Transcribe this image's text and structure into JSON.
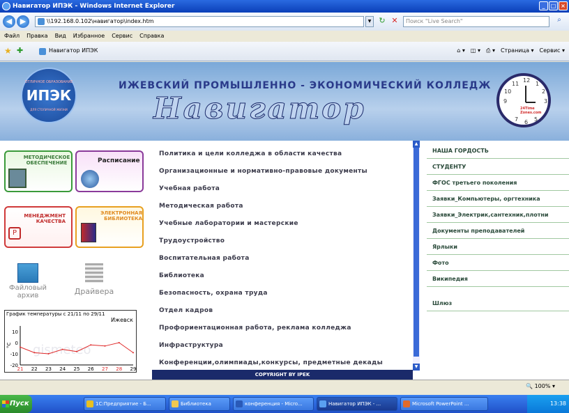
{
  "window": {
    "title": "Навигатор ИПЭК - Windows Internet Explorer"
  },
  "address": {
    "url": "\\\\192.168.0.102\\навигатор\\index.htm",
    "search_placeholder": "Поиск \"Live Search\""
  },
  "menu": [
    "Файл",
    "Правка",
    "Вид",
    "Избранное",
    "Сервис",
    "Справка"
  ],
  "tab": {
    "label": "Навигатор ИПЭК"
  },
  "commands": [
    "Страница ▾",
    "Сервис ▾"
  ],
  "banner": {
    "college": "ИЖЕВСКИЙ ПРОМЫШЛЕННО - ЭКОНОМИЧЕСКИЙ КОЛЛЕДЖ",
    "title": "Навигатор",
    "logo_top": "ОТЛИЧНОЕ ОБРАЗОВАНИЕ",
    "logo_main": "ИПЭК",
    "logo_bottom": "ДЛЯ СТОЛИЧНОЙ ЖИЗНИ",
    "clock_brand": "24Time Zones.com",
    "clock_numbers": [
      "12",
      "1",
      "2",
      "3",
      "5",
      "6",
      "7",
      "9",
      "10",
      "11"
    ]
  },
  "tiles": {
    "method": "МЕТОДИЧЕСКОЕ ОБЕСПЕЧЕНИЕ",
    "schedule": "Расписание",
    "management": "МЕНЕДЖМЕНТ КАЧЕСТВА",
    "library": "ЭЛЕКТРОННАЯ БИБЛИОТЕКА",
    "archive": "Файловый архив",
    "drivers": "Драйвера"
  },
  "middle_links": [
    "Политика и цели колледжа в области качества",
    "Организационные и нормативно-правовые документы",
    "Учебная работа",
    "Методическая работа",
    "Учебные лаборатории и мастерские",
    "Трудоустройство",
    "Воспитательная работа",
    "Библиотека",
    "Безопасность, охрана труда",
    "Отдел кадров",
    "Профориентационная работа, реклама колледжа",
    "Инфраструктура",
    "Конференции,олимпиады,конкурсы, предметные декады"
  ],
  "right_links": [
    "НАША ГОРДОСТЬ",
    "СТУДЕНТУ",
    "ФГОС третьего поколения",
    "Заявки_Компьютеры, оргтехника",
    "Заявки_Электрик,сантехник,плотни",
    "Документы преподавателей",
    "Ярлыки",
    "Фото",
    "Википедия",
    "Шлюз"
  ],
  "copyright": "COPYRIGHT BY IPEK",
  "status": {
    "zoom": "100%"
  },
  "taskbar": {
    "start": "Пуск",
    "items": [
      "1С:Предприятие - Б...",
      "Библиотека",
      "конференция - Micro...",
      "Навигатор ИПЭК - ...",
      "Microsoft PowerPoint ..."
    ],
    "clock": "13:38"
  },
  "chart_data": {
    "type": "line",
    "title": "График температуры с 21/11 по 29/11",
    "subtitle": "Ижевск",
    "ylabel": "°C",
    "watermark": "gismeteo",
    "categories": [
      "21",
      "22",
      "23",
      "24",
      "25",
      "26",
      "27",
      "28",
      "29"
    ],
    "y_ticks": [
      "10",
      "0",
      "-10",
      "-20"
    ],
    "ylim": [
      -20,
      15
    ],
    "values": [
      -4,
      -9,
      -10,
      -6,
      -8,
      -2,
      -3,
      0,
      -9
    ],
    "colors": {
      "line": "#e02a2a",
      "weekend": "#e02a2a"
    }
  }
}
